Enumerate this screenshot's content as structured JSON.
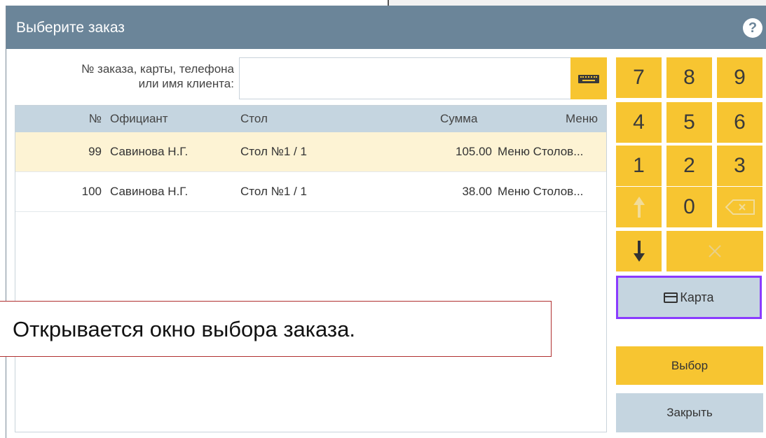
{
  "dialog": {
    "title": "Выберите заказ",
    "help_icon": "question-icon"
  },
  "search": {
    "label_line1": "№ заказа, карты, телефона",
    "label_line2": "или имя клиента:",
    "value": "",
    "placeholder": "",
    "keyboard_icon": "keyboard-icon"
  },
  "table": {
    "columns": [
      "№",
      "Официант",
      "Стол",
      "Сумма",
      "Меню"
    ],
    "rows": [
      {
        "num": "99",
        "waiter": "Савинова Н.Г.",
        "table": "Стол №1 / 1",
        "sum": "105.00",
        "menu": "Меню Столов..."
      },
      {
        "num": "100",
        "waiter": "Савинова Н.Г.",
        "table": "Стол №1 / 1",
        "sum": "38.00",
        "menu": "Меню Столов..."
      }
    ]
  },
  "keypad": {
    "keys": [
      "7",
      "8",
      "9",
      "4",
      "5",
      "6",
      "1",
      "2",
      "3",
      "0"
    ],
    "up_icon": "arrow-up-icon",
    "down_icon": "arrow-down-icon",
    "backspace_icon": "backspace-icon",
    "clear_icon": "clear-icon"
  },
  "buttons": {
    "card": "Карта",
    "card_icon": "credit-card-icon",
    "select": "Выбор",
    "close": "Закрыть"
  },
  "callout": {
    "text": "Открывается окно выбора заказа."
  },
  "colors": {
    "titlebar": "#6b8599",
    "accent_yellow": "#f7c531",
    "header_blue": "#c5d5e0",
    "selected_row": "#fdf3d4",
    "focus_border": "#8a3bff",
    "callout_border": "#b03030"
  }
}
